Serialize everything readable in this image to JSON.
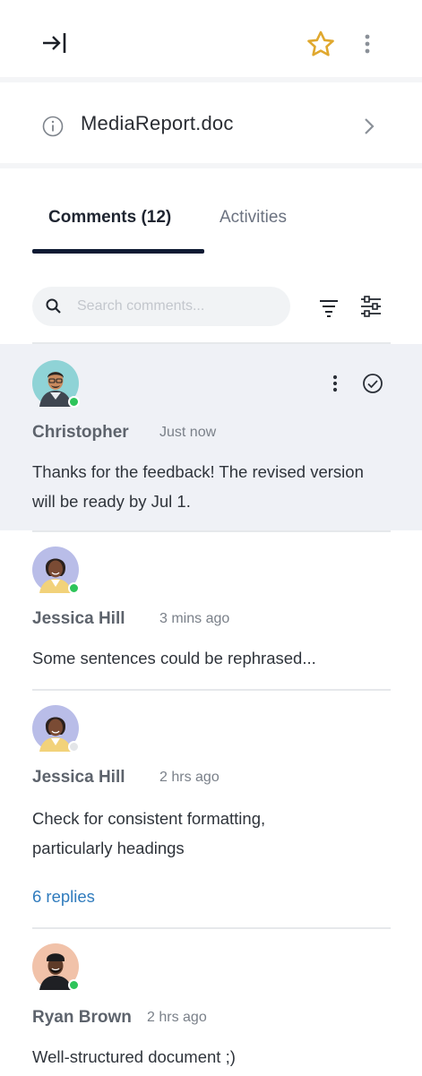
{
  "header": {
    "collapse_icon": "collapse-right-icon",
    "favorite_icon": "star-icon",
    "favorite_color": "#e0a82e",
    "more_icon": "more-vertical-icon"
  },
  "file": {
    "info_icon": "info-icon",
    "name": "MediaReport.doc",
    "chevron_icon": "chevron-right-icon"
  },
  "tabs": [
    {
      "label": "Comments (12)",
      "active": true
    },
    {
      "label": "Activities",
      "active": false
    }
  ],
  "search": {
    "placeholder": "Search comments...",
    "value": ""
  },
  "toolbar": {
    "sort_icon": "sort-lines-icon",
    "settings_icon": "sliders-icon"
  },
  "colors": {
    "accent": "#0e1a33",
    "online": "#2ec45a",
    "link": "#2f7bbd",
    "highlight": "#eff1f6"
  },
  "comments": [
    {
      "author": "Christopher",
      "time": "Just now",
      "text": "Thanks for the feedback! The revised version will be ready by Jul 1.",
      "online": true,
      "highlighted": true
    },
    {
      "author": "Jessica Hill",
      "time": "3 mins ago",
      "text": "Some sentences could be rephrased...",
      "online": true
    },
    {
      "author": "Jessica Hill",
      "time": "2 hrs ago",
      "text": "Check for consistent formatting, particularly headings",
      "online": false,
      "replies": "6 replies"
    },
    {
      "author": "Ryan Brown",
      "time": "2 hrs ago",
      "text": "Well-structured document ;)",
      "online": true
    }
  ]
}
